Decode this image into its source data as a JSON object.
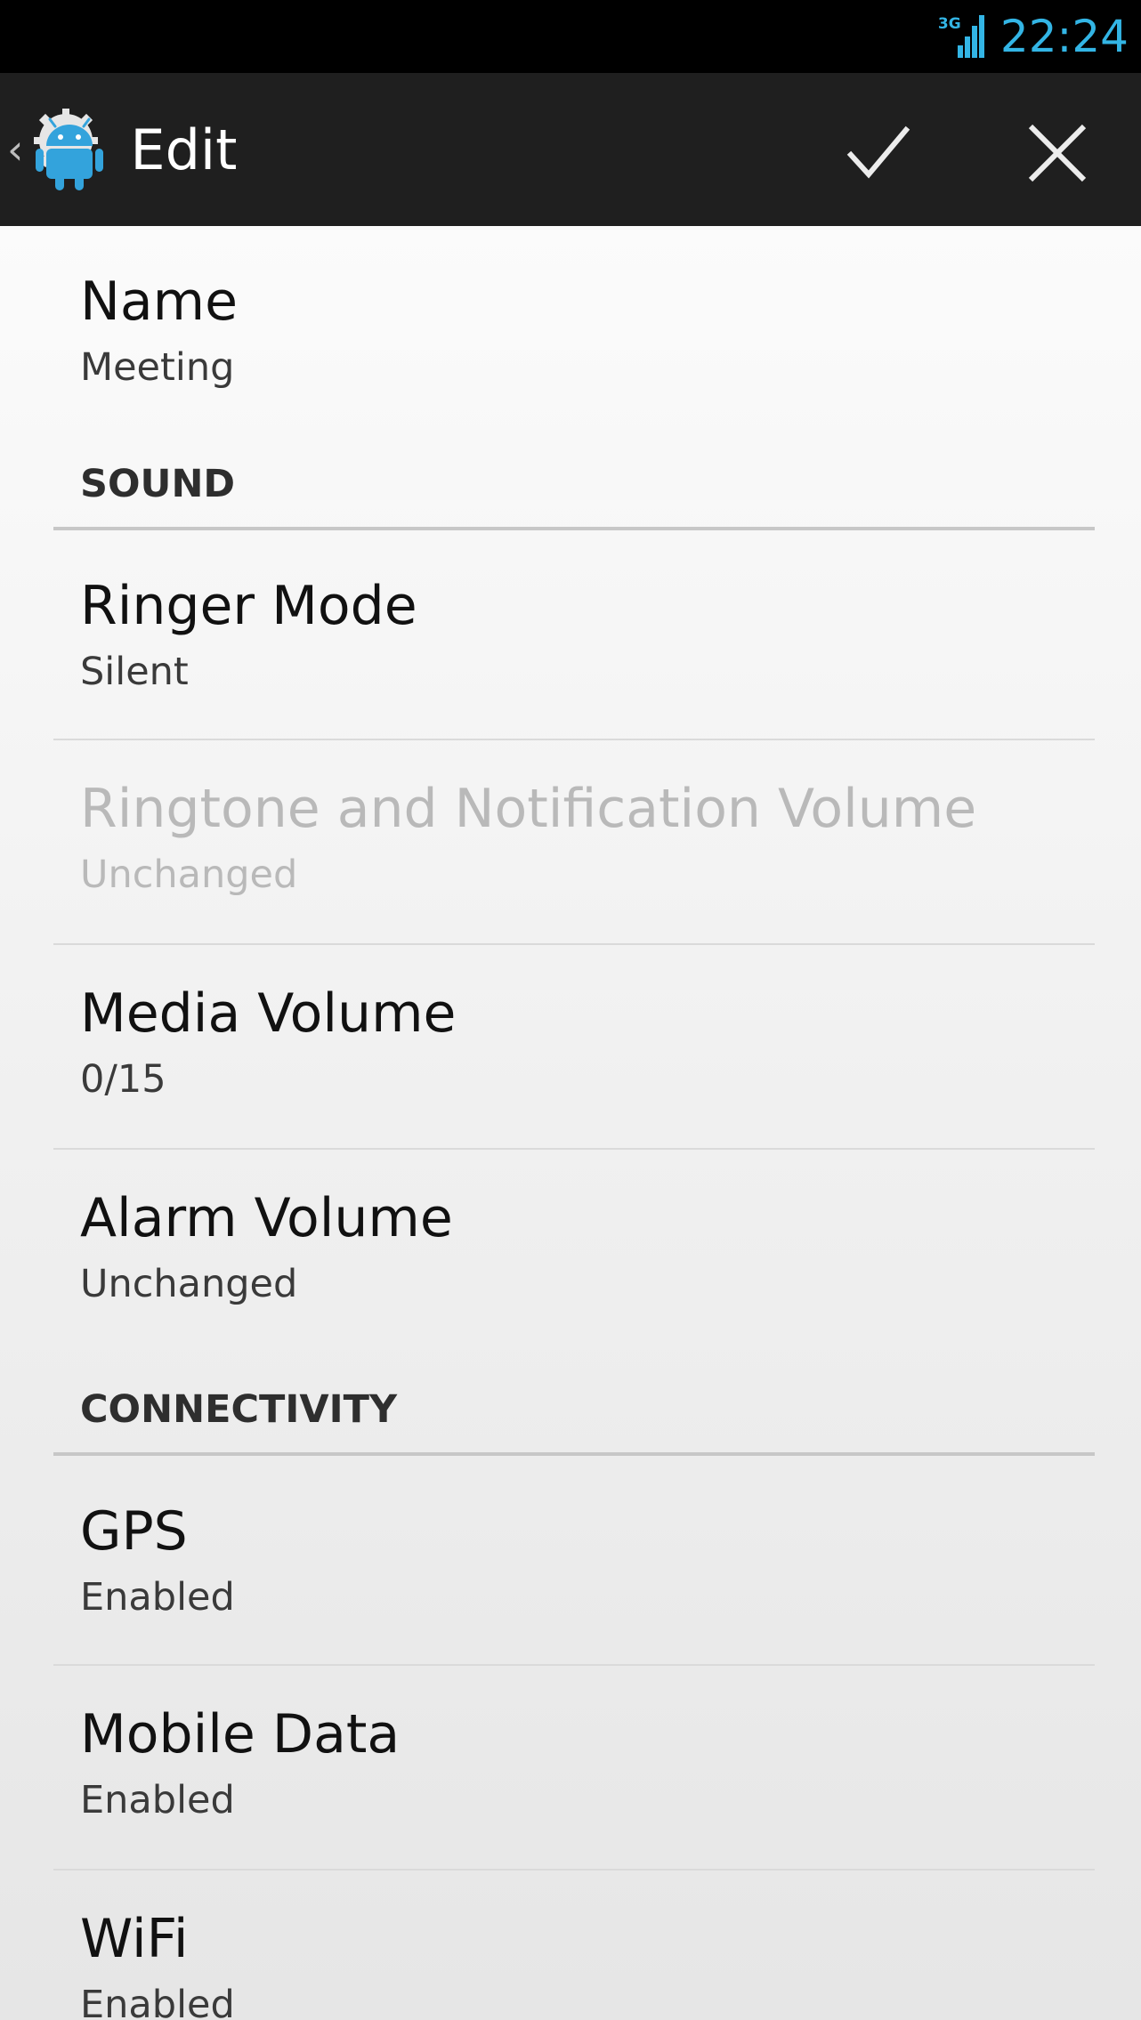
{
  "status_bar": {
    "network_type": "3G",
    "time": "22:24",
    "accent_color": "#33b5e5"
  },
  "action_bar": {
    "title": "Edit",
    "up_icon": "chevron-left-icon",
    "app_icon": "android-robot-icon",
    "confirm_icon": "checkmark-icon",
    "cancel_icon": "close-icon"
  },
  "preferences": {
    "name": {
      "title": "Name",
      "summary": "Meeting"
    },
    "sound": {
      "header": "SOUND",
      "ringer_mode": {
        "title": "Ringer Mode",
        "summary": "Silent"
      },
      "ringtone_volume": {
        "title": "Ringtone and Notification Volume",
        "summary": "Unchanged",
        "enabled": false
      },
      "media_volume": {
        "title": "Media Volume",
        "summary": "0/15"
      },
      "alarm_volume": {
        "title": "Alarm Volume",
        "summary": "Unchanged"
      }
    },
    "connectivity": {
      "header": "CONNECTIVITY",
      "gps": {
        "title": "GPS",
        "summary": "Enabled"
      },
      "mobile_data": {
        "title": "Mobile Data",
        "summary": "Enabled"
      },
      "wifi": {
        "title": "WiFi",
        "summary": "Enabled"
      }
    }
  }
}
